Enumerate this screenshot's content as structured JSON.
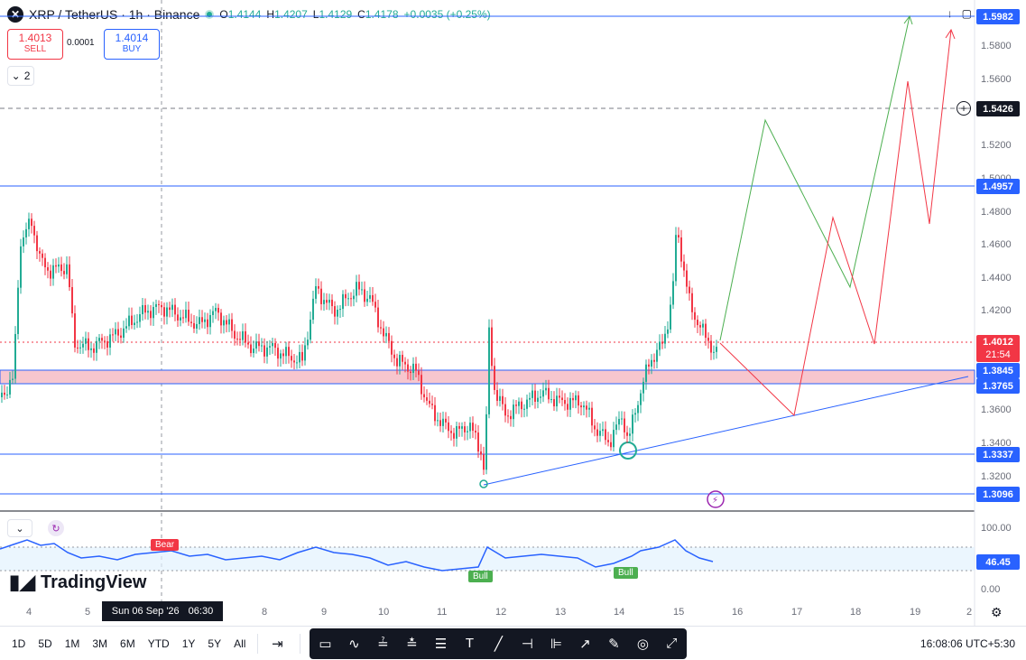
{
  "header": {
    "symbol": "XRP / TetherUS · 1h · Binance",
    "ohlc": [
      {
        "label": "O",
        "value": "1.4144"
      },
      {
        "label": "H",
        "value": "1.4207"
      },
      {
        "label": "L",
        "value": "1.4129"
      },
      {
        "label": "C",
        "value": "1.4178"
      }
    ],
    "change": "+0.0035 (+0.25%)"
  },
  "trade": {
    "sell_price": "1.4013",
    "sell_label": "SELL",
    "spread": "0.0001",
    "buy_price": "1.4014",
    "buy_label": "BUY"
  },
  "indicator_count": "2",
  "price_axis": {
    "ticks": [
      "1.5800",
      "1.5600",
      "1.5200",
      "1.5000",
      "1.4800",
      "1.4600",
      "1.4400",
      "1.4200",
      "1.3600",
      "1.3400",
      "1.3200"
    ],
    "tags": [
      {
        "value": "1.5982",
        "color": "#2962ff"
      },
      {
        "value": "1.5426",
        "color": "#131722"
      },
      {
        "value": "1.4957",
        "color": "#2962ff"
      },
      {
        "value": "1.4012",
        "color": "#f23645"
      },
      {
        "value": "1.3845",
        "color": "#2962ff"
      },
      {
        "value": "1.3765",
        "color": "#2962ff"
      },
      {
        "value": "1.3337",
        "color": "#2962ff"
      },
      {
        "value": "1.3096",
        "color": "#2962ff"
      }
    ],
    "countdown": "21:54"
  },
  "rsi": {
    "ticks": [
      "100.00",
      "0.00"
    ],
    "current": "46.45",
    "badges": {
      "bear": "Bear",
      "bull1": "Bull",
      "bull2": "Bull"
    }
  },
  "time_axis": {
    "labels": [
      "4",
      "5",
      "8",
      "9",
      "10",
      "11",
      "12",
      "13",
      "14",
      "15",
      "16",
      "17",
      "18",
      "19",
      "2"
    ],
    "crosshair_date": "Sun 06 Sep '26",
    "crosshair_time": "06:30"
  },
  "branding": "TradingView",
  "toolbar": {
    "timeframes": [
      "1D",
      "5D",
      "1M",
      "3M",
      "6M",
      "YTD",
      "1Y",
      "5Y",
      "All"
    ],
    "clock": "16:08:06 UTC+5:30"
  },
  "colors": {
    "up": "#22ab94",
    "down": "#f23645",
    "line": "#2962ff",
    "zone": "#f7c6ce"
  }
}
